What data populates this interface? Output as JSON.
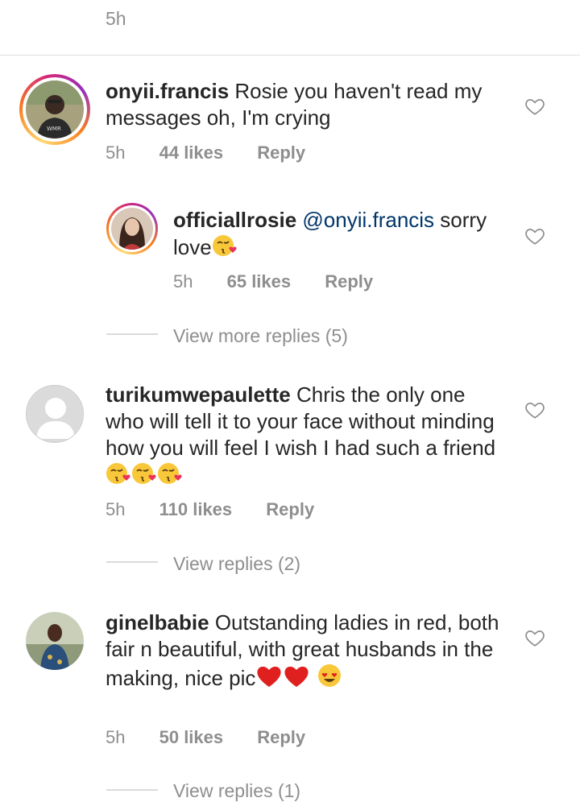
{
  "top": {
    "time": "5h"
  },
  "comments": [
    {
      "username": "onyii.francis",
      "text": "Rosie you haven't read my messages oh, I'm crying",
      "time": "5h",
      "likes": "44 likes",
      "reply": "Reply",
      "replies": [
        {
          "username": "officiallrosie",
          "mention": "@onyii.francis",
          "text": "sorry love",
          "time": "5h",
          "likes": "65 likes",
          "reply": "Reply"
        }
      ],
      "view_replies": "View more replies (5)"
    },
    {
      "username": "turikumwepaulette",
      "text": "Chris the only one who will tell it to your face without minding how you will feel I wish I had such a friend",
      "time": "5h",
      "likes": "110 likes",
      "reply": "Reply",
      "view_replies": "View replies (2)"
    },
    {
      "username": "ginelbabie",
      "text": "Outstanding ladies in red, both fair n beautiful, with great husbands in the making, nice pic",
      "time": "5h",
      "likes": "50 likes",
      "reply": "Reply",
      "view_replies": "View replies (1)"
    }
  ],
  "colors": {
    "text": "#262626",
    "muted": "#8e8e8e",
    "mention": "#003569",
    "divider": "#dbdbdb"
  },
  "icons": {
    "like": "heart-outline-icon",
    "kiss": "face-blowing-kiss-emoji",
    "red_heart": "red-heart-emoji",
    "heart_eyes": "heart-eyes-emoji"
  }
}
